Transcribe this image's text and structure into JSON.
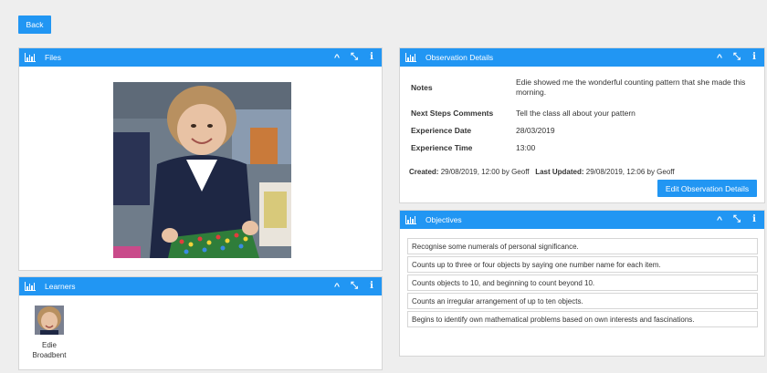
{
  "toolbar": {
    "back_label": "Back"
  },
  "files": {
    "title": "Files",
    "photo_colors": {
      "background": "#6f7c8a",
      "jacket": "#1e2744",
      "hair": "#b89060",
      "face": "#e8c2a4",
      "board": "#2f7d3a"
    }
  },
  "learners": {
    "title": "Learners",
    "items": [
      {
        "first": "Edie",
        "last": "Broadbent"
      }
    ]
  },
  "observation": {
    "title": "Observation Details",
    "fields": [
      {
        "label": "Notes",
        "value": "Edie showed me the wonderful counting pattern that she made this morning."
      },
      {
        "label": "Next Steps Comments",
        "value": "Tell the class all about your pattern"
      },
      {
        "label": "Experience Date",
        "value": "28/03/2019"
      },
      {
        "label": "Experience Time",
        "value": "13:00"
      }
    ],
    "created_label": "Created:",
    "created_value": "29/08/2019, 12:00 by Geoff",
    "updated_label": "Last Updated:",
    "updated_value": "29/08/2019, 12:06 by Geoff",
    "edit_label": "Edit Observation Details"
  },
  "objectives": {
    "title": "Objectives",
    "items": [
      "Recognise some numerals of personal significance.",
      "Counts up to three or four objects by saying one number name for each item.",
      "Counts objects to 10, and beginning to count beyond 10.",
      "Counts an irregular arrangement of up to ten objects.",
      "Begins to identify own mathematical problems based on own interests and fascinations."
    ]
  },
  "icons": {
    "chart": "bar-chart-icon",
    "collapse": "chevron-up-icon",
    "expand": "expand-icon",
    "info": "info-icon"
  },
  "colors": {
    "accent": "#2196f3",
    "page_bg": "#eeeeee"
  }
}
